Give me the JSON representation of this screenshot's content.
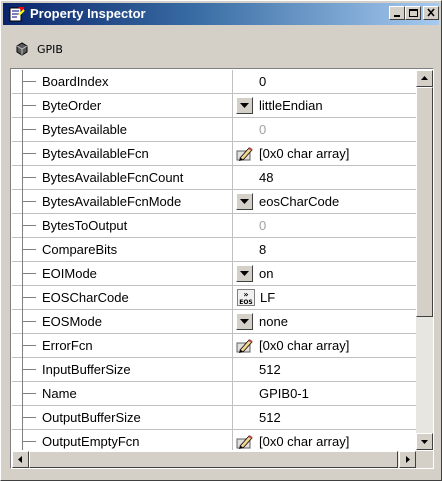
{
  "window": {
    "title": "Property Inspector",
    "object_label": "GPIB"
  },
  "properties": [
    {
      "name": "BoardIndex",
      "value": "0",
      "control": "none",
      "disabled": false
    },
    {
      "name": "ByteOrder",
      "value": "littleEndian",
      "control": "dropdown",
      "disabled": false
    },
    {
      "name": "BytesAvailable",
      "value": "0",
      "control": "none",
      "disabled": true
    },
    {
      "name": "BytesAvailableFcn",
      "value": "[0x0  char array]",
      "control": "edit",
      "disabled": false
    },
    {
      "name": "BytesAvailableFcnCount",
      "value": "48",
      "control": "none",
      "disabled": false
    },
    {
      "name": "BytesAvailableFcnMode",
      "value": "eosCharCode",
      "control": "dropdown",
      "disabled": false
    },
    {
      "name": "BytesToOutput",
      "value": "0",
      "control": "none",
      "disabled": true
    },
    {
      "name": "CompareBits",
      "value": "8",
      "control": "none",
      "disabled": false
    },
    {
      "name": "EOIMode",
      "value": "on",
      "control": "dropdown",
      "disabled": false
    },
    {
      "name": "EOSCharCode",
      "value": "LF",
      "control": "eos",
      "disabled": false
    },
    {
      "name": "EOSMode",
      "value": "none",
      "control": "dropdown",
      "disabled": false
    },
    {
      "name": "ErrorFcn",
      "value": "[0x0  char array]",
      "control": "edit",
      "disabled": false
    },
    {
      "name": "InputBufferSize",
      "value": "512",
      "control": "none",
      "disabled": false
    },
    {
      "name": "Name",
      "value": "GPIB0-1",
      "control": "none",
      "disabled": false
    },
    {
      "name": "OutputBufferSize",
      "value": "512",
      "control": "none",
      "disabled": false
    },
    {
      "name": "OutputEmptyFcn",
      "value": "[0x0  char array]",
      "control": "edit",
      "disabled": false
    }
  ],
  "eos_icon_text": {
    "top": "»",
    "bottom": "EOS"
  },
  "colors": {
    "title_start": "#0a246a",
    "title_end": "#a6caf0",
    "face": "#d4d0c8",
    "disabled_text": "#a0a0a0"
  }
}
